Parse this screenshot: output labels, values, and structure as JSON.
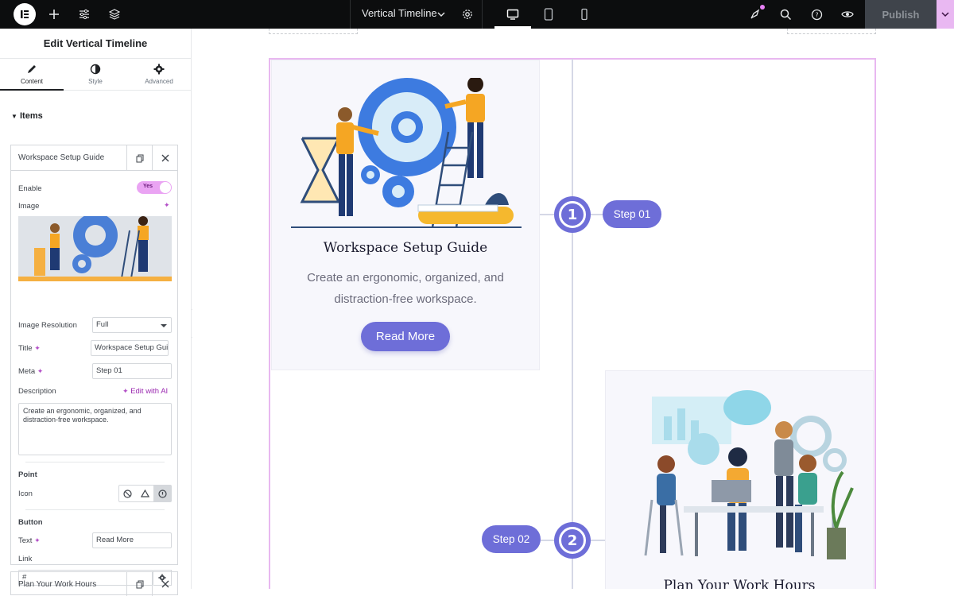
{
  "topbar": {
    "doc_title": "Vertical Timeline",
    "publish_label": "Publish"
  },
  "panel": {
    "title": "Edit Vertical Timeline",
    "tabs": [
      {
        "label": "Content",
        "icon": "pencil-icon"
      },
      {
        "label": "Style",
        "icon": "half-circle-icon"
      },
      {
        "label": "Advanced",
        "icon": "gear-icon"
      }
    ],
    "section_label": "Items",
    "item1": {
      "header": "Workspace Setup Guide",
      "enable_label": "Enable",
      "enable_value": "Yes",
      "image_label": "Image",
      "image_resolution_label": "Image Resolution",
      "image_resolution_value": "Full",
      "title_label": "Title",
      "title_value": "Workspace Setup Guide",
      "meta_label": "Meta",
      "meta_value": "Step 01",
      "description_label": "Description",
      "edit_ai_label": "Edit with AI",
      "description_value": "Create an ergonomic, organized, and distraction-free workspace.",
      "point_label": "Point",
      "icon_label": "Icon",
      "button_label": "Button",
      "text_label": "Text",
      "text_value": "Read More",
      "link_label": "Link",
      "link_value": "#"
    },
    "item2_header": "Plan Your Work Hours"
  },
  "timeline": {
    "items": [
      {
        "title": "Workspace Setup Guide",
        "description_line1": "Create an ergonomic, organized, and",
        "description_line2": "distraction-free workspace.",
        "button": "Read More",
        "meta": "Step 01",
        "number": "1"
      },
      {
        "title": "Plan Your Work Hours",
        "meta": "Step 02",
        "number": "2"
      }
    ]
  },
  "colors": {
    "accent": "#6e6ed8",
    "publish_caret": "#e9b8f2",
    "toggle_on": "#eaa4f3"
  }
}
